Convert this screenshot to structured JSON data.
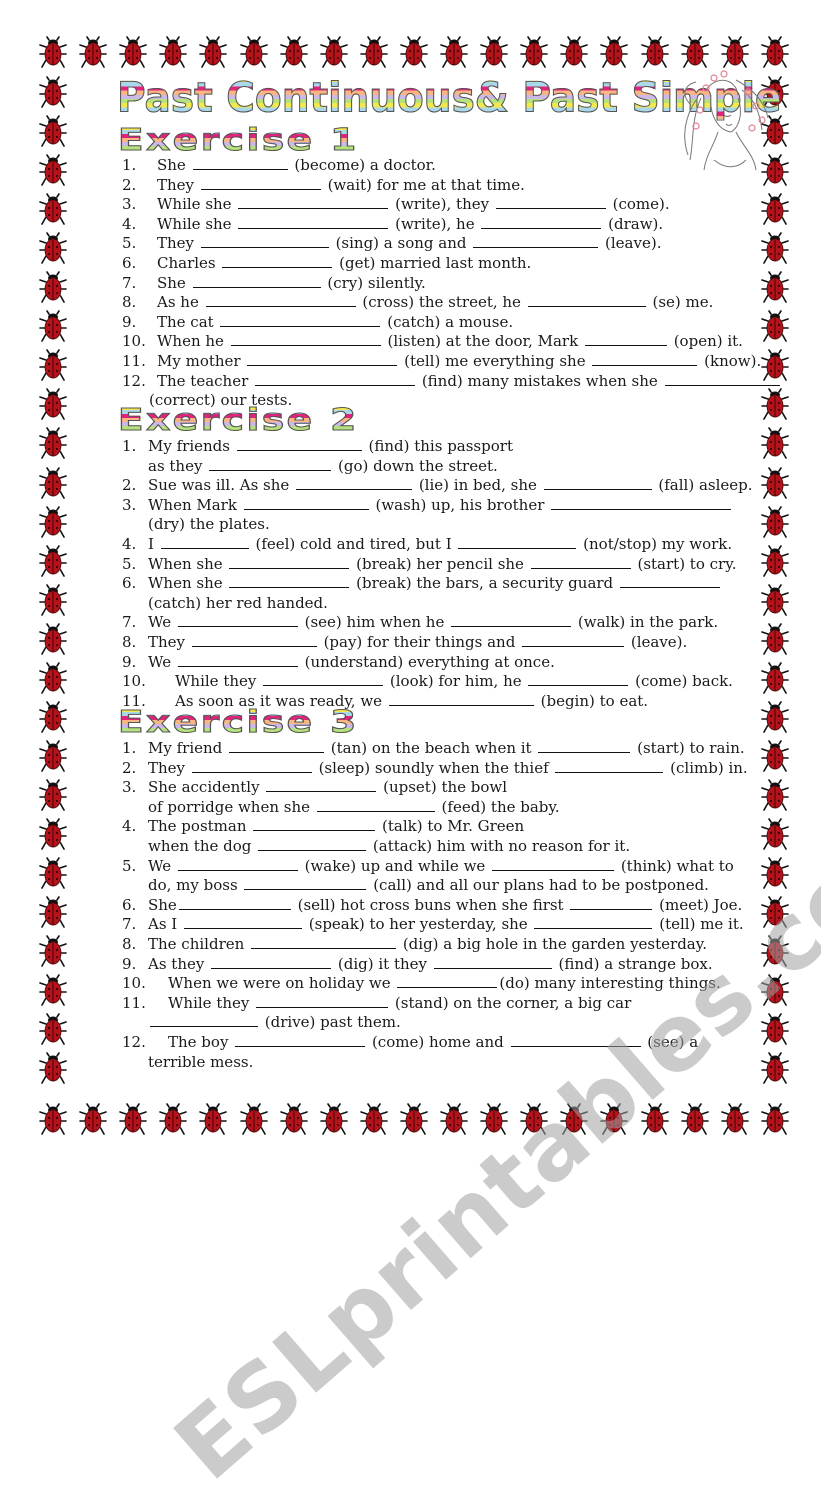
{
  "title": "Past Continuous& Past Simple",
  "watermark": "ESLprintables.com",
  "colors": {
    "ladybug_red": "#b5121b",
    "ladybug_black": "#111111",
    "stripe_yellow": "#f3e84c",
    "stripe_blue": "#a9d8ea",
    "stripe_magenta": "#e2237d",
    "stripe_peach": "#f7b682",
    "stripe_lavender": "#cdb8ea",
    "stripe_green": "#b6e27e"
  },
  "decorations": {
    "border_icon": "ladybug-icon",
    "illustration": "girl-with-polka-dot-headscarf-sketch"
  },
  "exercises": [
    {
      "heading": "Exercise 1",
      "items": [
        {
          "num": "1.",
          "lines": [
            "She ___ (become) a doctor."
          ]
        },
        {
          "num": "2.",
          "lines": [
            "They ___ (wait) for me at that time."
          ]
        },
        {
          "num": "3.",
          "lines": [
            "While she ___ (write), they ___ (come)."
          ]
        },
        {
          "num": "4.",
          "lines": [
            "While she ___ (write), he ___ (draw)."
          ]
        },
        {
          "num": "5.",
          "lines": [
            "They ___ (sing) a song and ___ (leave)."
          ]
        },
        {
          "num": "6.",
          "lines": [
            "Charles ___ (get) married last month."
          ]
        },
        {
          "num": "7.",
          "lines": [
            "She ___ (cry) silently."
          ]
        },
        {
          "num": "8.",
          "lines": [
            "As he ___ (cross) the street, he ___ (se) me."
          ]
        },
        {
          "num": "9.",
          "lines": [
            "The cat ___ (catch) a mouse."
          ]
        },
        {
          "num": "10.",
          "lines": [
            "When he ___ (listen) at the door, Mark ___ (open) it."
          ]
        },
        {
          "num": "11.",
          "lines": [
            "My mother ___ (tell) me everything she ___ (know)."
          ]
        },
        {
          "num": "12.",
          "lines": [
            "The teacher ___ (find) many mistakes when she ___",
            "(correct) our tests."
          ]
        }
      ]
    },
    {
      "heading": "Exercise 2",
      "items": [
        {
          "num": "1.",
          "lines": [
            "My friends ___ (find) this passport",
            "as they ___ (go) down the street."
          ]
        },
        {
          "num": "2.",
          "lines": [
            "Sue was ill. As she ___ (lie) in bed, she ___ (fall) asleep."
          ]
        },
        {
          "num": "3.",
          "lines": [
            "When Mark ___ (wash) up, his brother ___",
            "(dry) the plates."
          ]
        },
        {
          "num": "4.",
          "lines": [
            "I ___ (feel) cold and tired, but I ___ (not/stop) my work."
          ]
        },
        {
          "num": "5.",
          "lines": [
            "When she ___ (break) her pencil she ___ (start) to cry."
          ]
        },
        {
          "num": "6.",
          "lines": [
            "When she ___ (break) the bars, a security guard ___",
            "(catch) her red handed."
          ]
        },
        {
          "num": "7.",
          "lines": [
            "We ___ (see) him when he ___ (walk) in the park."
          ]
        },
        {
          "num": "8.",
          "lines": [
            "They ___ (pay) for their things and ___ (leave)."
          ]
        },
        {
          "num": "9.",
          "lines": [
            "We ___ (understand) everything at once."
          ]
        },
        {
          "num": "10.",
          "lines": [
            "While they ___ (look) for him, he ___ (come) back."
          ]
        },
        {
          "num": "11.",
          "lines": [
            "As soon as it was ready, we ___ (begin) to eat."
          ]
        }
      ]
    },
    {
      "heading": "Exercise 3",
      "items": [
        {
          "num": "1.",
          "lines": [
            "My friend ___ (tan) on the beach when it ___ (start) to rain."
          ]
        },
        {
          "num": "2.",
          "lines": [
            "They ___ (sleep) soundly when the thief ___ (climb) in."
          ]
        },
        {
          "num": "3.",
          "lines": [
            "She accidently ___ (upset) the bowl",
            "of porridge when she ___ (feed) the baby."
          ]
        },
        {
          "num": "4.",
          "lines": [
            "The postman ___ (talk) to Mr. Green",
            "when the dog ___ (attack) him with no reason for it."
          ]
        },
        {
          "num": "5.",
          "lines": [
            "We ___ (wake) up and while we ___ (think) what to",
            "do, my boss ___ (call) and all our plans had to be postponed."
          ]
        },
        {
          "num": "6.",
          "lines": [
            "She___ (sell) hot cross buns when she first ___ (meet) Joe."
          ]
        },
        {
          "num": "7.",
          "lines": [
            "As I ___ (speak) to her yesterday, she ___ (tell) me it."
          ]
        },
        {
          "num": "8.",
          "lines": [
            "The children ___ (dig) a big hole in the garden yesterday."
          ]
        },
        {
          "num": "9.",
          "lines": [
            "As they ___ (dig) it they ___ (find) a strange box."
          ]
        },
        {
          "num": "10.",
          "lines": [
            "When we were on holiday we ___(do) many interesting things."
          ]
        },
        {
          "num": "11.",
          "lines": [
            "While they ___ (stand) on the corner, a big car",
            "___ (drive) past them."
          ]
        },
        {
          "num": "12.",
          "lines": [
            "The boy ___ (come) home and ___ (see) a",
            "terrible mess."
          ]
        }
      ]
    }
  ]
}
